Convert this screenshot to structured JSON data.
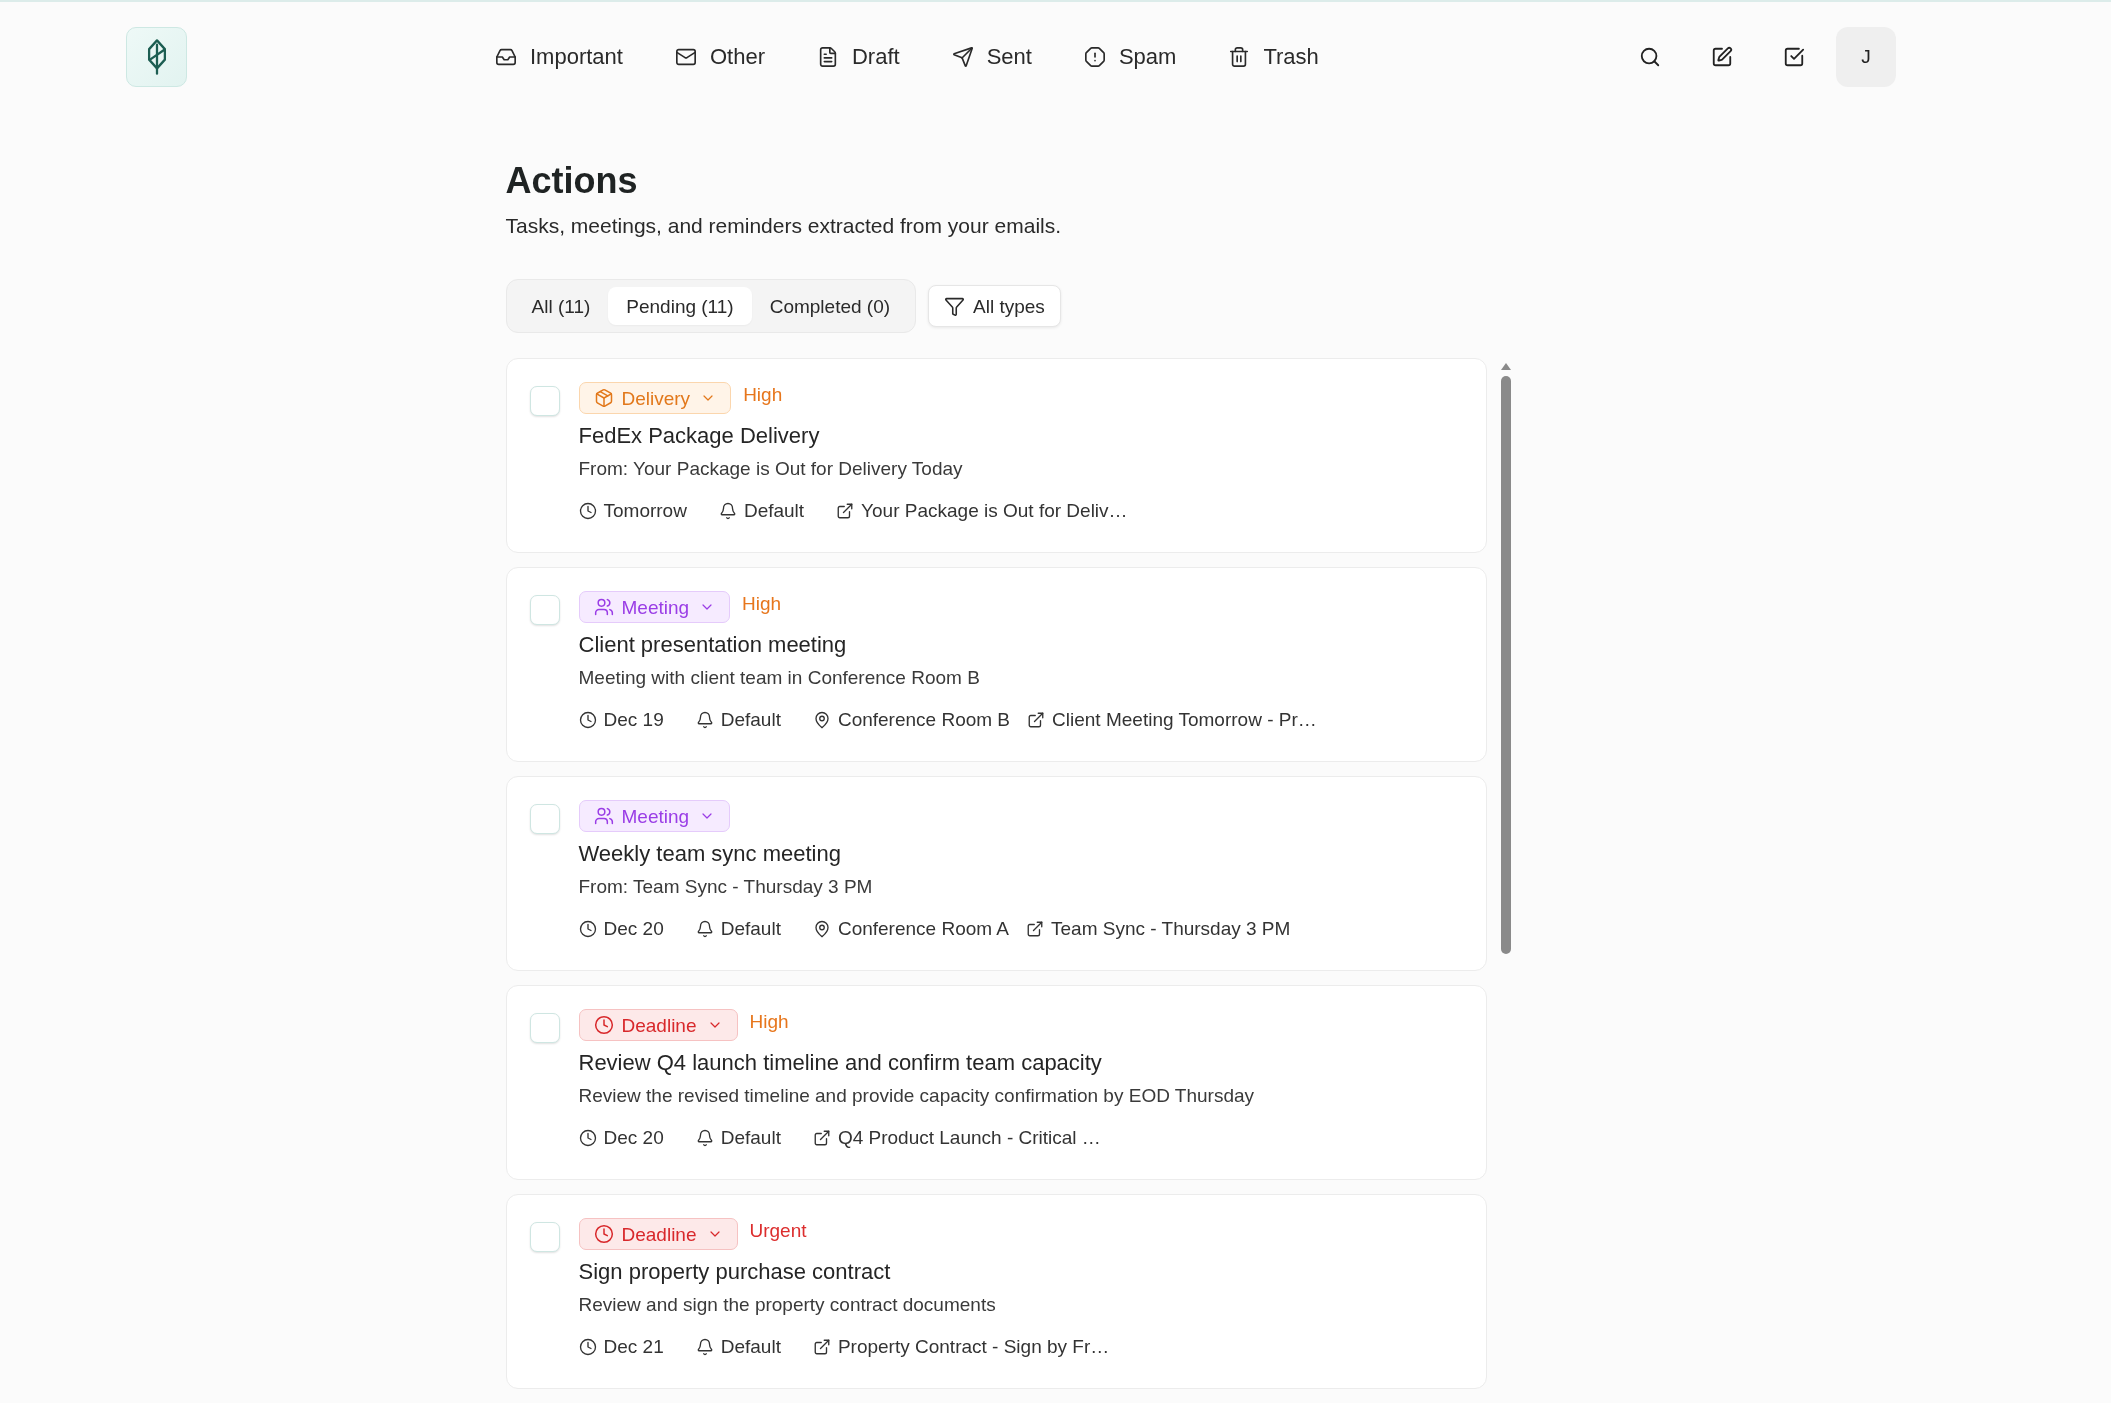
{
  "nav": {
    "items": [
      {
        "label": "Important"
      },
      {
        "label": "Other"
      },
      {
        "label": "Draft"
      },
      {
        "label": "Sent"
      },
      {
        "label": "Spam"
      },
      {
        "label": "Trash"
      }
    ]
  },
  "user": {
    "initial": "J"
  },
  "page": {
    "title": "Actions",
    "subtitle": "Tasks, meetings, and reminders extracted from your emails."
  },
  "tabs": [
    {
      "label": "All (11)",
      "selected": false
    },
    {
      "label": "Pending (11)",
      "selected": true
    },
    {
      "label": "Completed (0)",
      "selected": false
    }
  ],
  "filter": {
    "label": "All types"
  },
  "actions": [
    {
      "checked": false,
      "type": {
        "kind": "delivery",
        "label": "Delivery"
      },
      "priority": {
        "kind": "high",
        "label": "High"
      },
      "title": "FedEx Package Delivery",
      "description": "From: Your Package is Out for Delivery Today",
      "meta": [
        {
          "kind": "due",
          "text": "Tomorrow"
        },
        {
          "kind": "reminder",
          "text": "Default"
        },
        {
          "kind": "source",
          "text": "Your Package is Out for Deliv…"
        }
      ]
    },
    {
      "checked": false,
      "type": {
        "kind": "meeting",
        "label": "Meeting"
      },
      "priority": {
        "kind": "high",
        "label": "High"
      },
      "title": "Client presentation meeting",
      "description": "Meeting with client team in Conference Room B",
      "meta": [
        {
          "kind": "due",
          "text": "Dec 19"
        },
        {
          "kind": "reminder",
          "text": "Default"
        },
        {
          "kind": "location",
          "text": "Conference Room B"
        },
        {
          "kind": "source",
          "text": "Client Meeting Tomorrow - Pr…"
        }
      ]
    },
    {
      "checked": false,
      "type": {
        "kind": "meeting",
        "label": "Meeting"
      },
      "title": "Weekly team sync meeting",
      "description": "From: Team Sync - Thursday 3 PM",
      "meta": [
        {
          "kind": "due",
          "text": "Dec 20"
        },
        {
          "kind": "reminder",
          "text": "Default"
        },
        {
          "kind": "location",
          "text": "Conference Room A"
        },
        {
          "kind": "source",
          "text": "Team Sync - Thursday 3 PM"
        }
      ]
    },
    {
      "checked": false,
      "type": {
        "kind": "deadline",
        "label": "Deadline"
      },
      "priority": {
        "kind": "high",
        "label": "High"
      },
      "title": "Review Q4 launch timeline and confirm team capacity",
      "description": "Review the revised timeline and provide capacity confirmation by EOD Thursday",
      "meta": [
        {
          "kind": "due",
          "text": "Dec 20"
        },
        {
          "kind": "reminder",
          "text": "Default"
        },
        {
          "kind": "source",
          "text": "Q4 Product Launch - Critical …"
        }
      ]
    },
    {
      "checked": false,
      "type": {
        "kind": "deadline",
        "label": "Deadline"
      },
      "priority": {
        "kind": "urgent",
        "label": "Urgent"
      },
      "title": "Sign property purchase contract",
      "description": "Review and sign the property contract documents",
      "meta": [
        {
          "kind": "due",
          "text": "Dec 21"
        },
        {
          "kind": "reminder",
          "text": "Default"
        },
        {
          "kind": "source",
          "text": "Property Contract - Sign by Fr…"
        }
      ]
    }
  ]
}
